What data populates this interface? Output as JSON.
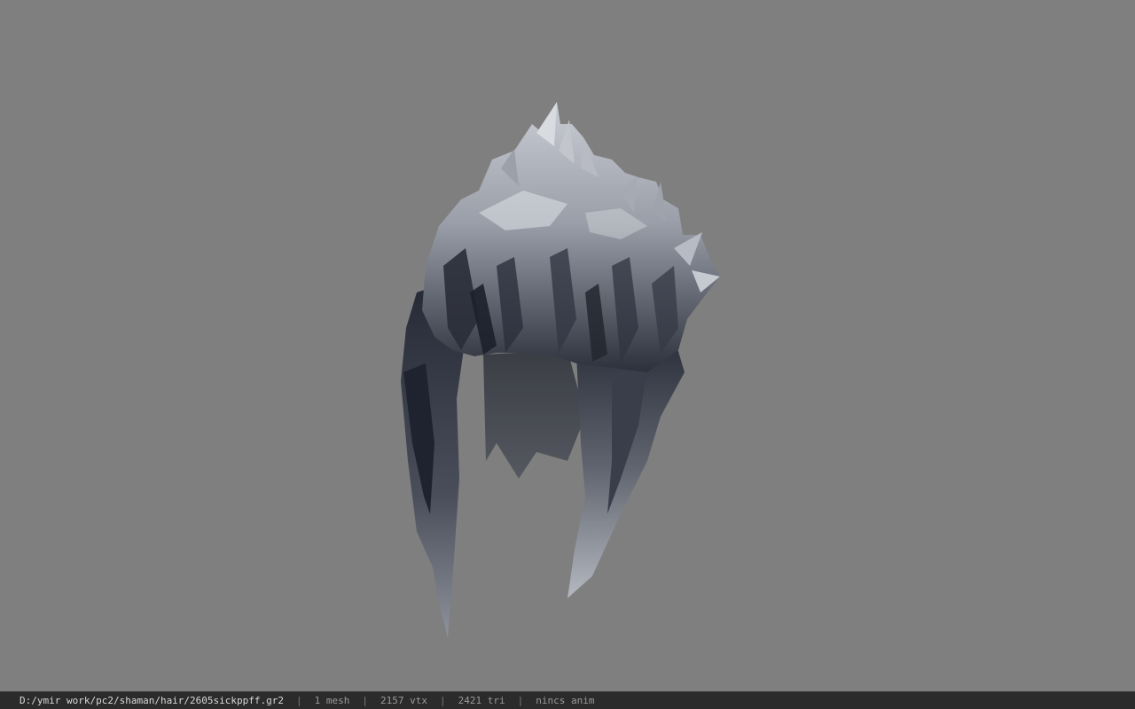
{
  "viewport": {
    "background_color": "#7f7f7f",
    "model_icon": "hair-mesh-icon"
  },
  "status": {
    "file_path": "D:/ymir work/pc2/shaman/hair/2605sickppff.gr2",
    "mesh_count": "1 mesh",
    "vertex_count": "2157 vtx",
    "triangle_count": "2421 tri",
    "anim_status": "nincs anim",
    "separator": "|"
  }
}
